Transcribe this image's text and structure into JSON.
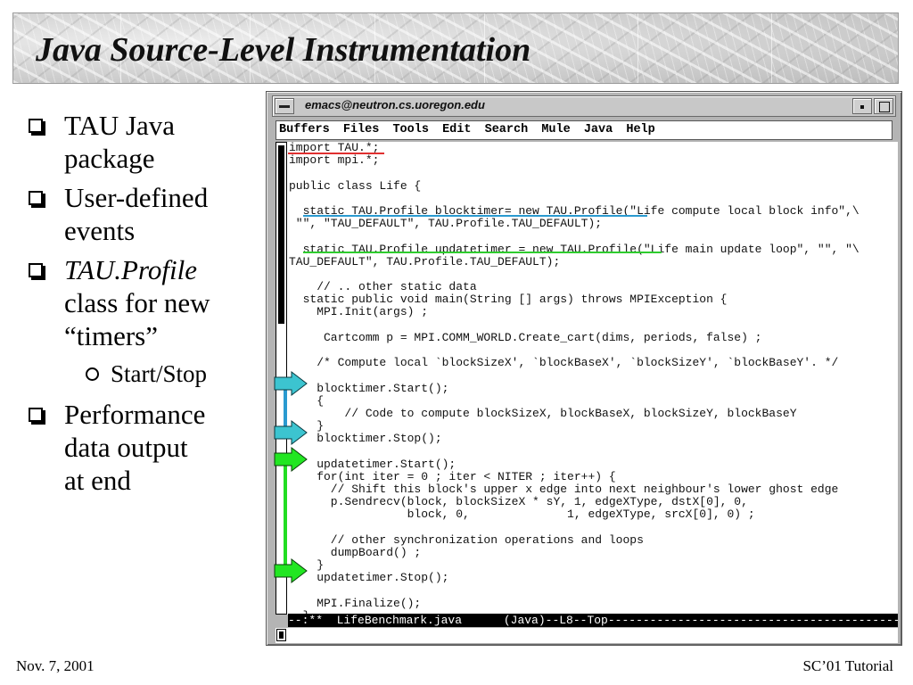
{
  "slide": {
    "title": "Java Source-Level Instrumentation",
    "footer_left": "Nov. 7, 2001",
    "footer_right": "SC’01 Tutorial"
  },
  "bullets": [
    {
      "lines": [
        "TAU Java",
        "package"
      ]
    },
    {
      "lines": [
        "User-defined",
        "events"
      ]
    },
    {
      "italic": "TAU.Profile",
      "lines": [
        "class for new",
        "“timers”"
      ]
    },
    {
      "sub": "Start/Stop"
    },
    {
      "lines": [
        "Performance",
        "data output",
        "at end"
      ]
    }
  ],
  "window": {
    "title": "emacs@neutron.cs.uoregon.edu",
    "menu": [
      "Buffers",
      "Files",
      "Tools",
      "Edit",
      "Search",
      "Mule",
      "Java",
      "Help"
    ],
    "code_lines": [
      "import TAU.*;",
      "import mpi.*;",
      "",
      "public class Life {",
      "",
      "  static TAU.Profile blocktimer= new TAU.Profile(\"Life compute local block info\",\\",
      " \"\", \"TAU_DEFAULT\", TAU.Profile.TAU_DEFAULT);",
      "",
      "  static TAU.Profile updatetimer = new TAU.Profile(\"Life main update loop\", \"\", \"\\",
      "TAU_DEFAULT\", TAU.Profile.TAU_DEFAULT);",
      "",
      "    // .. other static data",
      "  static public void main(String [] args) throws MPIException {",
      "    MPI.Init(args) ;",
      "",
      "     Cartcomm p = MPI.COMM_WORLD.Create_cart(dims, periods, false) ;",
      "",
      "    /* Compute local `blockSizeX', `blockBaseX', `blockSizeY', `blockBaseY'. */",
      "",
      "    blocktimer.Start();",
      "    {",
      "        // Code to compute blockSizeX, blockBaseX, blockSizeY, blockBaseY",
      "    }",
      "    blocktimer.Stop();",
      "",
      "    updatetimer.Start();",
      "    for(int iter = 0 ; iter < NITER ; iter++) {",
      "      // Shift this block's upper x edge into next neighbour's lower ghost edge",
      "      p.Sendrecv(block, blockSizeX * sY, 1, edgeXType, dstX[0], 0,",
      "                 block, 0,              1, edgeXType, srcX[0], 0) ;",
      "",
      "      // other synchronization operations and loops",
      "      dumpBoard() ;",
      "    }",
      "    updatetimer.Stop();",
      "",
      "    MPI.Finalize();",
      "  }"
    ],
    "modeline": "--:**  LifeBenchmark.java      (Java)--L8--Top--------------------------------------------"
  },
  "colors": {
    "underline_red": "#e03030",
    "underline_blue": "#2a9ad0",
    "underline_green": "#2ecc2e",
    "arrow_cyan": "#3cc4d0",
    "arrow_green": "#22e622"
  }
}
